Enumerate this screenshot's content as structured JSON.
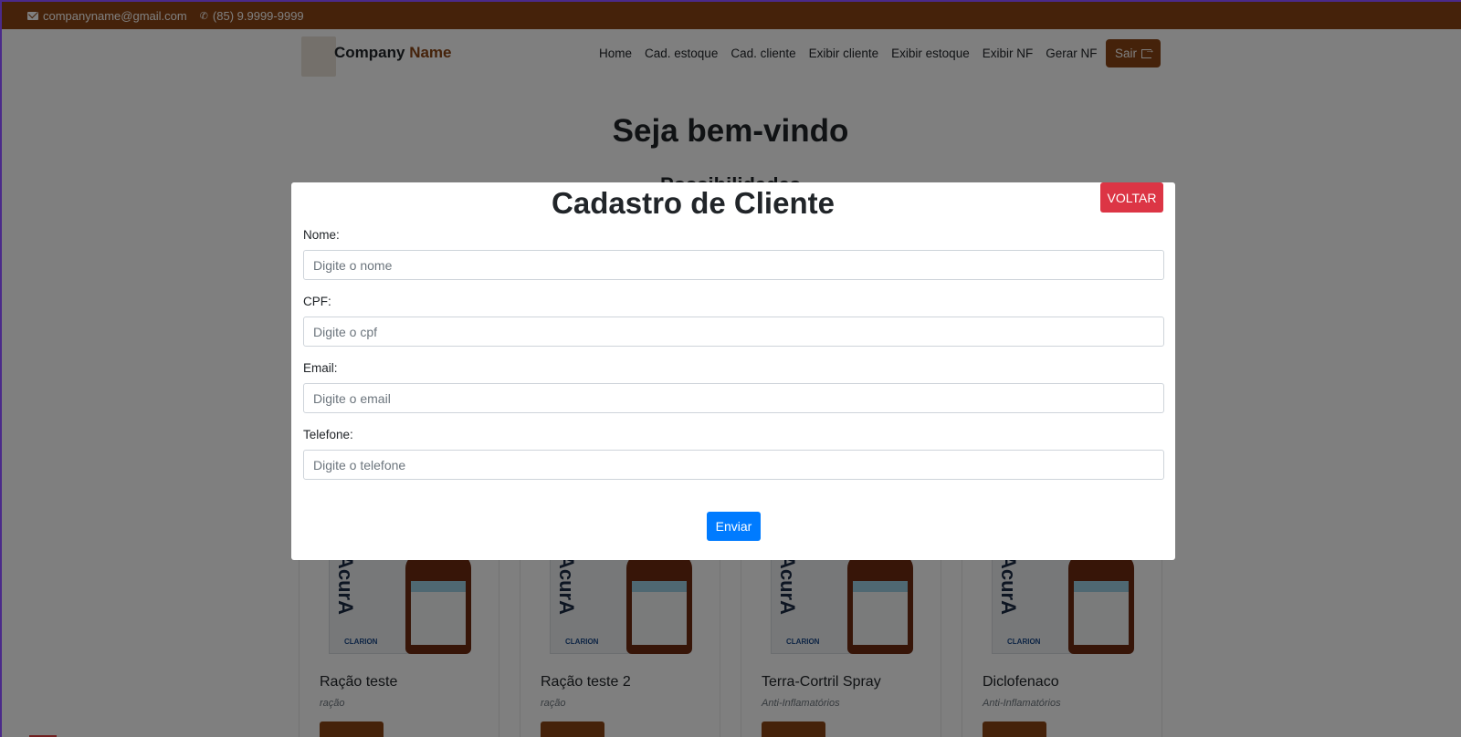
{
  "topbar": {
    "email": "companyname@gmail.com",
    "phone": "(85) 9.9999-9999",
    "background_color": "#8a4514"
  },
  "navbar": {
    "brand_first": "Company",
    "brand_second": "Name",
    "links": [
      "Home",
      "Cad. estoque",
      "Cad. cliente",
      "Exibir cliente",
      "Exibir estoque",
      "Exibir NF",
      "Gerar NF"
    ],
    "logout_label": "Sair",
    "accent_color": "#8a4514"
  },
  "main": {
    "welcome": "Seja bem-vindo",
    "subtitle": "Possibilidades"
  },
  "products": [
    {
      "name": "Ração teste",
      "category": "ração"
    },
    {
      "name": "Ração teste 2",
      "category": "ração"
    },
    {
      "name": "Terra-Cortril Spray",
      "category": "Anti-Inflamatórios"
    },
    {
      "name": "Diclofenaco",
      "category": "Anti-Inflamatórios"
    }
  ],
  "product_image": {
    "box_text": "AcurA",
    "brand_logo": "CLARION"
  },
  "modal": {
    "title": "Cadastro de Cliente",
    "close_label": "VOLTAR",
    "fields": [
      {
        "label": "Nome:",
        "placeholder": "Digite o nome",
        "value": ""
      },
      {
        "label": "CPF:",
        "placeholder": "Digite o cpf",
        "value": ""
      },
      {
        "label": "Email:",
        "placeholder": "Digite o email",
        "value": ""
      },
      {
        "label": "Telefone:",
        "placeholder": "Digite o telefone",
        "value": ""
      }
    ],
    "submit_label": "Enviar",
    "submit_color": "#007bff",
    "close_color": "#dc3545"
  }
}
